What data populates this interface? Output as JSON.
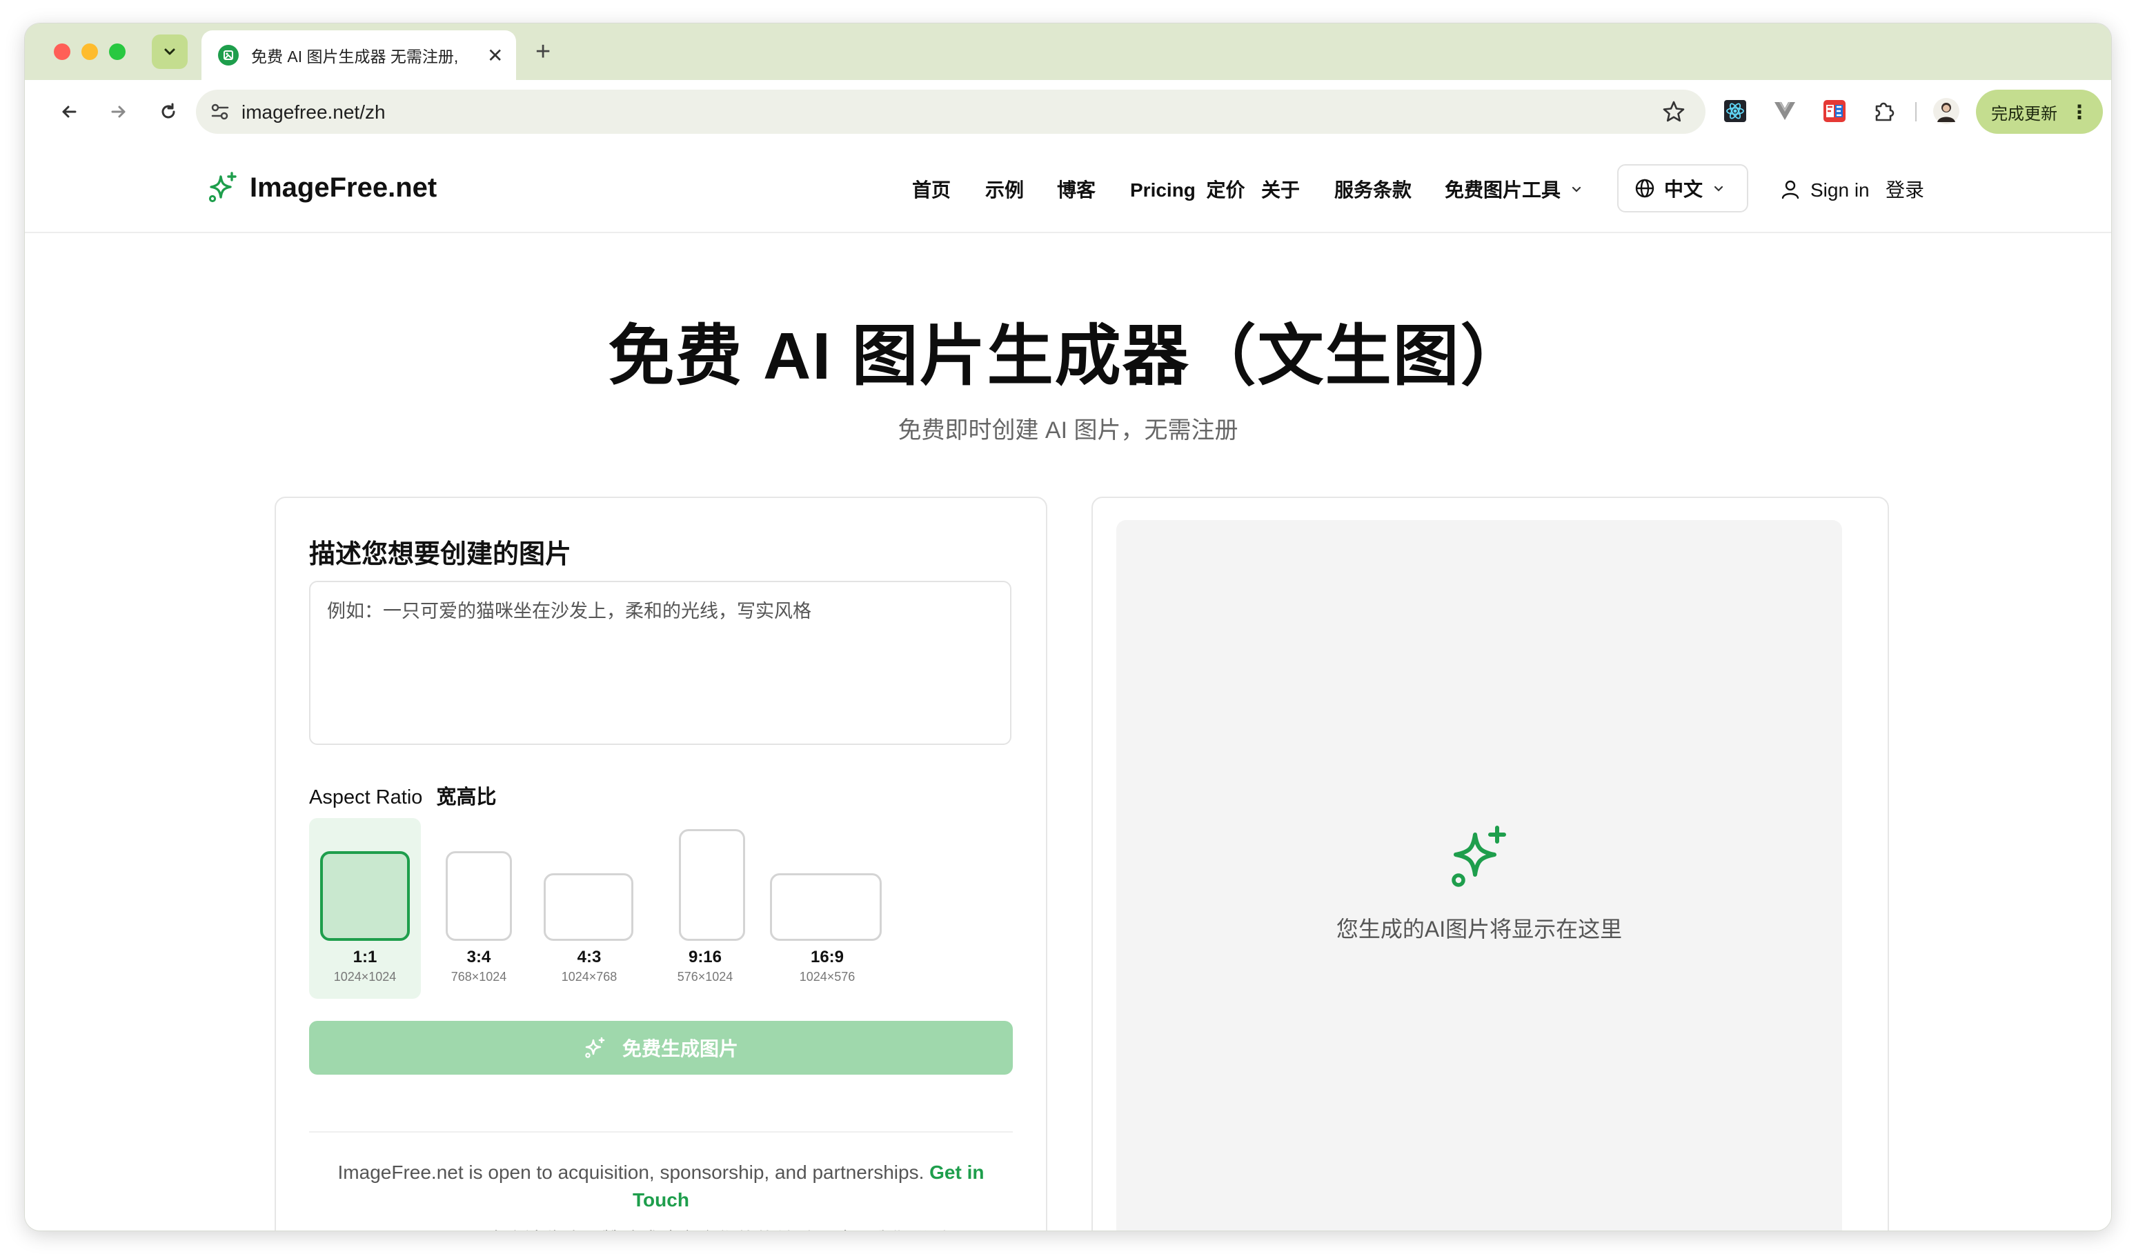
{
  "browser": {
    "tab_title": "免费 AI 图片生成器 无需注册,",
    "tab_close": "✕",
    "new_tab": "+",
    "url": "imagefree.net/zh",
    "update_button": "完成更新",
    "update_menu": "⋮"
  },
  "site": {
    "logo": "ImageFree.net",
    "nav": {
      "home": "首页",
      "examples": "示例",
      "blog": "博客",
      "pricing": "Pricing  定价",
      "about": "关于",
      "terms": "服务条款",
      "tools": "免费图片工具"
    },
    "language": "中文",
    "signin": "Sign in   登录"
  },
  "hero": {
    "title": "免费 AI 图片生成器（文生图）",
    "subtitle": "免费即时创建 AI 图片，无需注册"
  },
  "form": {
    "title": "描述您想要创建的图片",
    "prompt_placeholder": "例如：一只可爱的猫咪坐在沙发上，柔和的光线，写实风格",
    "aspect_label": "Aspect Ratio",
    "aspect_label_zh": "宽高比",
    "ratios": [
      {
        "label": "1:1",
        "size": "1024×1024",
        "selected": true
      },
      {
        "label": "3:4",
        "size": "768×1024",
        "selected": false
      },
      {
        "label": "4:3",
        "size": "1024×768",
        "selected": false
      },
      {
        "label": "9:16",
        "size": "576×1024",
        "selected": false
      },
      {
        "label": "16:9",
        "size": "1024×576",
        "selected": false
      }
    ],
    "generate_button": "免费生成图片",
    "note_text": "ImageFree.net is open to acquisition, sponsorship, and partnerships.",
    "note_link": "Get in Touch",
    "note_zh": "ImageFree.net 欢迎被收购、赞助或建立合作伙伴关系。请与我们联系。"
  },
  "preview": {
    "placeholder_text": "您生成的AI图片将显示在这里"
  },
  "colors": {
    "brand_green": "#1e9e4c",
    "button_disabled": "#9fd8ac",
    "chrome_tabstrip": "#dfe8cf",
    "chrome_accent": "#c4dd8f"
  }
}
